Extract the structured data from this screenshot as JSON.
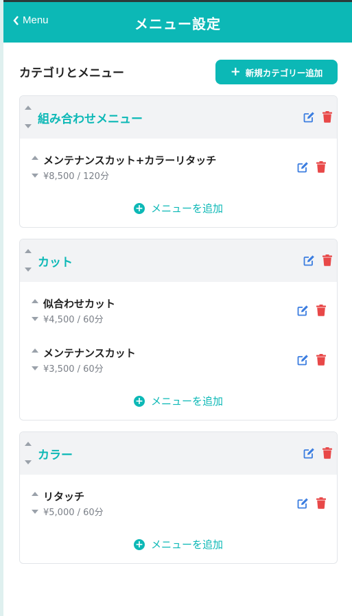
{
  "header": {
    "back_label": "Menu",
    "title": "メニュー設定"
  },
  "section": {
    "title": "カテゴリとメニュー",
    "add_category_label": "新規カテゴリー追加"
  },
  "add_menu_label": "メニューを追加",
  "categories": [
    {
      "name": "組み合わせメニュー",
      "items": [
        {
          "name": "メンテナンスカット+カラーリタッチ",
          "price": "¥8,500 / 120分"
        }
      ]
    },
    {
      "name": "カット",
      "items": [
        {
          "name": "似合わせカット",
          "price": "¥4,500 / 60分"
        },
        {
          "name": "メンテナンスカット",
          "price": "¥3,500 / 60分"
        }
      ]
    },
    {
      "name": "カラー",
      "items": [
        {
          "name": "リタッチ",
          "price": "¥5,000 / 60分"
        }
      ]
    }
  ],
  "colors": {
    "accent": "#0cb8b6",
    "edit": "#3b7de0",
    "delete": "#e84848"
  }
}
